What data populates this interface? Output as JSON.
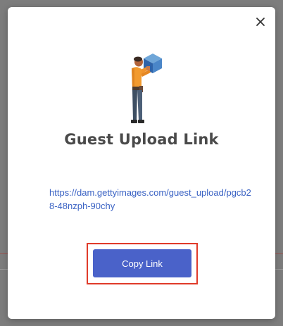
{
  "modal": {
    "title": "Guest Upload Link",
    "link_url": "https://dam.gettyimages.com/guest_upload/pgcb28-48nzph-90chy",
    "copy_button_label": "Copy Link",
    "close_icon": "close-icon",
    "illustration": "person-holding-box-illustration"
  },
  "colors": {
    "title": "#4a4a4a",
    "link": "#3b63c4",
    "button": "#4a62c9",
    "highlight": "#e03b2a",
    "backdrop": "#7d7d7d"
  }
}
